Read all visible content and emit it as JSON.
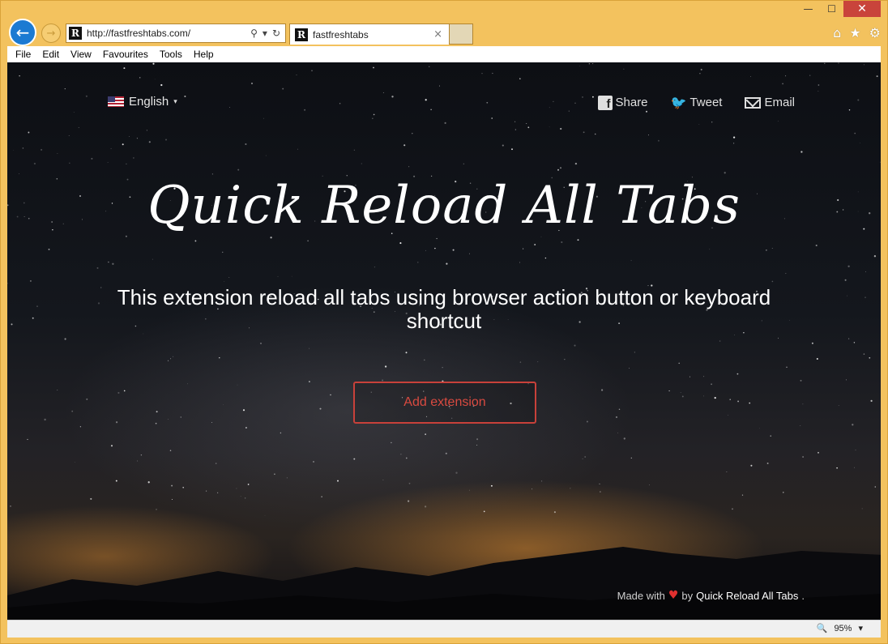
{
  "window": {
    "controls": {
      "minimize": "—",
      "maximize": "☐",
      "close": "✕"
    }
  },
  "nav": {
    "back_icon": "←",
    "forward_icon": "→",
    "address": {
      "favicon": "R",
      "url": "http://fastfreshtabs.com/",
      "search_icon": "⚲",
      "dropdown_icon": "▾",
      "refresh_icon": "↻"
    },
    "tab": {
      "favicon": "R",
      "title": "fastfreshtabs",
      "close": "×"
    },
    "right_icons": {
      "home": "⌂",
      "favorites": "★",
      "settings": "⚙"
    }
  },
  "menubar": {
    "items": [
      "File",
      "Edit",
      "View",
      "Favourites",
      "Tools",
      "Help"
    ]
  },
  "page": {
    "language": {
      "label": "English",
      "caret": "▾"
    },
    "social": {
      "share": "Share",
      "tweet": "Tweet",
      "email": "Email",
      "fb_glyph": "f",
      "tw_glyph": "🐦"
    },
    "title": "Quick Reload All Tabs",
    "subtitle": "This extension reload all tabs using browser action button or keyboard shortcut",
    "cta": "Add extension",
    "footer": {
      "made_with": "Made with",
      "heart": "♥",
      "by": "by",
      "brand": "Quick Reload All Tabs",
      "period": "."
    }
  },
  "statusbar": {
    "zoom_icon": "🔍",
    "zoom": "95%",
    "zoom_caret": "▾"
  },
  "colors": {
    "frame": "#f3c25e",
    "accent_blue": "#1b7ad2",
    "cta_red": "#d94a40",
    "heart": "#e0302f"
  }
}
